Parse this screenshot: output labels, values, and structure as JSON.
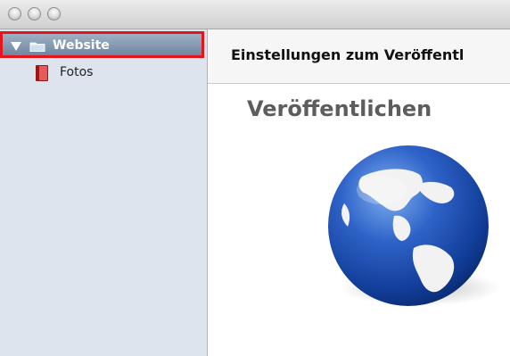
{
  "window": {
    "title_bar_buttons": [
      "close",
      "minimize",
      "zoom"
    ]
  },
  "sidebar": {
    "selected_item": {
      "label": "Website",
      "expanded": true,
      "icon": "folder-icon",
      "highlight_color": "#e8141b"
    },
    "items": [
      {
        "label": "Fotos",
        "icon": "book-icon"
      }
    ]
  },
  "main": {
    "header_title": "Einstellungen zum Veröffentl",
    "section_title": "Veröffentlichen",
    "illustration": "globe-icon"
  }
}
